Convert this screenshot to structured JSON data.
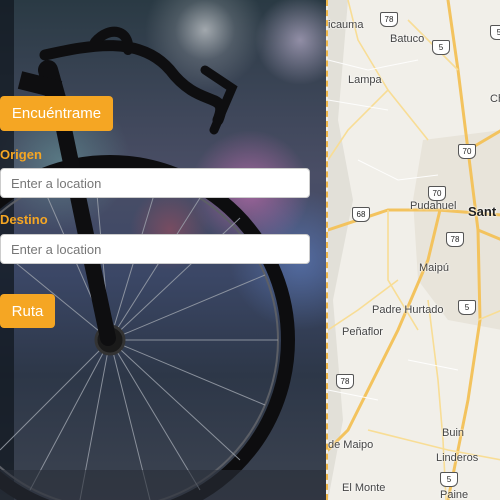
{
  "controls": {
    "locate_label": "Encuéntrame",
    "origin_label": "Origen",
    "origin_placeholder": "Enter a location",
    "destination_label": "Destino",
    "destination_placeholder": "Enter a location",
    "route_label": "Ruta",
    "accent_color": "#f5a623"
  },
  "map": {
    "places": {
      "p1": "Colina / Chicauma",
      "p1_text": "icauma",
      "batuco": "Batuco",
      "lampa": "Lampa",
      "pudahuel": "Pudahuel",
      "santiago": "Sant",
      "maipu": "Maipú",
      "padre_hurtado": "Padre Hurtado",
      "penaflor": "Peñaflor",
      "isla_maipo": "de Maipo",
      "buin": "Buin",
      "linderos": "Linderos",
      "el_monte": "El Monte",
      "paine": "Paine",
      "ch": "Ch"
    },
    "shields": {
      "s5a": "5",
      "s5b": "5",
      "s70a": "70",
      "s70b": "70",
      "s68": "68",
      "s78a": "78",
      "s78b": "78",
      "s78c": "78",
      "s5c": "5",
      "s5d": "5"
    }
  }
}
